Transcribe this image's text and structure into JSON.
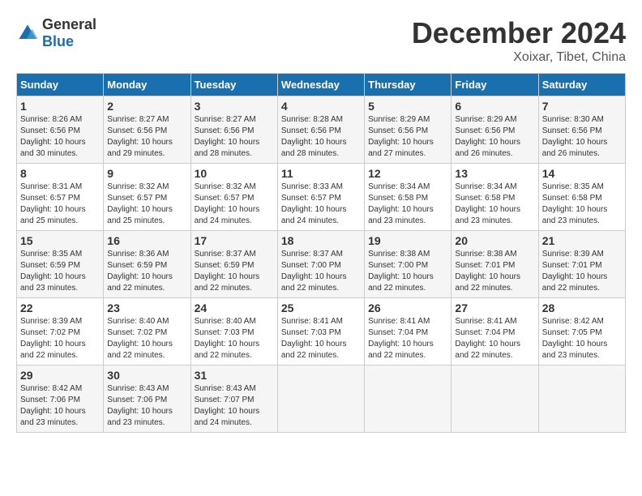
{
  "logo": {
    "general": "General",
    "blue": "Blue"
  },
  "title": "December 2024",
  "location": "Xoixar, Tibet, China",
  "days_of_week": [
    "Sunday",
    "Monday",
    "Tuesday",
    "Wednesday",
    "Thursday",
    "Friday",
    "Saturday"
  ],
  "weeks": [
    [
      {
        "day": "1",
        "sunrise": "8:26 AM",
        "sunset": "6:56 PM",
        "daylight": "10 hours and 30 minutes."
      },
      {
        "day": "2",
        "sunrise": "8:27 AM",
        "sunset": "6:56 PM",
        "daylight": "10 hours and 29 minutes."
      },
      {
        "day": "3",
        "sunrise": "8:27 AM",
        "sunset": "6:56 PM",
        "daylight": "10 hours and 28 minutes."
      },
      {
        "day": "4",
        "sunrise": "8:28 AM",
        "sunset": "6:56 PM",
        "daylight": "10 hours and 28 minutes."
      },
      {
        "day": "5",
        "sunrise": "8:29 AM",
        "sunset": "6:56 PM",
        "daylight": "10 hours and 27 minutes."
      },
      {
        "day": "6",
        "sunrise": "8:29 AM",
        "sunset": "6:56 PM",
        "daylight": "10 hours and 26 minutes."
      },
      {
        "day": "7",
        "sunrise": "8:30 AM",
        "sunset": "6:56 PM",
        "daylight": "10 hours and 26 minutes."
      }
    ],
    [
      {
        "day": "8",
        "sunrise": "8:31 AM",
        "sunset": "6:57 PM",
        "daylight": "10 hours and 25 minutes."
      },
      {
        "day": "9",
        "sunrise": "8:32 AM",
        "sunset": "6:57 PM",
        "daylight": "10 hours and 25 minutes."
      },
      {
        "day": "10",
        "sunrise": "8:32 AM",
        "sunset": "6:57 PM",
        "daylight": "10 hours and 24 minutes."
      },
      {
        "day": "11",
        "sunrise": "8:33 AM",
        "sunset": "6:57 PM",
        "daylight": "10 hours and 24 minutes."
      },
      {
        "day": "12",
        "sunrise": "8:34 AM",
        "sunset": "6:58 PM",
        "daylight": "10 hours and 23 minutes."
      },
      {
        "day": "13",
        "sunrise": "8:34 AM",
        "sunset": "6:58 PM",
        "daylight": "10 hours and 23 minutes."
      },
      {
        "day": "14",
        "sunrise": "8:35 AM",
        "sunset": "6:58 PM",
        "daylight": "10 hours and 23 minutes."
      }
    ],
    [
      {
        "day": "15",
        "sunrise": "8:35 AM",
        "sunset": "6:59 PM",
        "daylight": "10 hours and 23 minutes."
      },
      {
        "day": "16",
        "sunrise": "8:36 AM",
        "sunset": "6:59 PM",
        "daylight": "10 hours and 22 minutes."
      },
      {
        "day": "17",
        "sunrise": "8:37 AM",
        "sunset": "6:59 PM",
        "daylight": "10 hours and 22 minutes."
      },
      {
        "day": "18",
        "sunrise": "8:37 AM",
        "sunset": "7:00 PM",
        "daylight": "10 hours and 22 minutes."
      },
      {
        "day": "19",
        "sunrise": "8:38 AM",
        "sunset": "7:00 PM",
        "daylight": "10 hours and 22 minutes."
      },
      {
        "day": "20",
        "sunrise": "8:38 AM",
        "sunset": "7:01 PM",
        "daylight": "10 hours and 22 minutes."
      },
      {
        "day": "21",
        "sunrise": "8:39 AM",
        "sunset": "7:01 PM",
        "daylight": "10 hours and 22 minutes."
      }
    ],
    [
      {
        "day": "22",
        "sunrise": "8:39 AM",
        "sunset": "7:02 PM",
        "daylight": "10 hours and 22 minutes."
      },
      {
        "day": "23",
        "sunrise": "8:40 AM",
        "sunset": "7:02 PM",
        "daylight": "10 hours and 22 minutes."
      },
      {
        "day": "24",
        "sunrise": "8:40 AM",
        "sunset": "7:03 PM",
        "daylight": "10 hours and 22 minutes."
      },
      {
        "day": "25",
        "sunrise": "8:41 AM",
        "sunset": "7:03 PM",
        "daylight": "10 hours and 22 minutes."
      },
      {
        "day": "26",
        "sunrise": "8:41 AM",
        "sunset": "7:04 PM",
        "daylight": "10 hours and 22 minutes."
      },
      {
        "day": "27",
        "sunrise": "8:41 AM",
        "sunset": "7:04 PM",
        "daylight": "10 hours and 22 minutes."
      },
      {
        "day": "28",
        "sunrise": "8:42 AM",
        "sunset": "7:05 PM",
        "daylight": "10 hours and 23 minutes."
      }
    ],
    [
      {
        "day": "29",
        "sunrise": "8:42 AM",
        "sunset": "7:06 PM",
        "daylight": "10 hours and 23 minutes."
      },
      {
        "day": "30",
        "sunrise": "8:43 AM",
        "sunset": "7:06 PM",
        "daylight": "10 hours and 23 minutes."
      },
      {
        "day": "31",
        "sunrise": "8:43 AM",
        "sunset": "7:07 PM",
        "daylight": "10 hours and 24 minutes."
      },
      null,
      null,
      null,
      null
    ]
  ],
  "labels": {
    "sunrise_prefix": "Sunrise: ",
    "sunset_prefix": "Sunset: ",
    "daylight_prefix": "Daylight: "
  }
}
